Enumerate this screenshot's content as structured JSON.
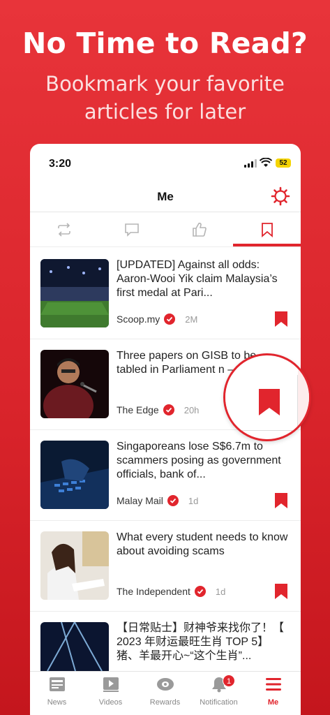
{
  "hero": {
    "title": "No Time to Read?",
    "subtitle": "Bookmark your favorite articles for later"
  },
  "status": {
    "time": "3:20",
    "battery": "52"
  },
  "topbar": {
    "title": "Me"
  },
  "tabs": [
    {
      "icon": "repost-icon"
    },
    {
      "icon": "comment-icon"
    },
    {
      "icon": "like-icon"
    },
    {
      "icon": "bookmark-icon",
      "active": true
    }
  ],
  "articles": [
    {
      "headline": "[UPDATED] Against all odds: Aaron-Wooi Yik claim Malaysia’s first medal at Pari...",
      "source": "Scoop.my",
      "age": "2M"
    },
    {
      "headline": "Three papers on GISB to be tabled in Parliament n — Azalina",
      "source": "The Edge",
      "age": "20h"
    },
    {
      "headline": "Singaporeans lose S$6.7m to scammers posing as government officials, bank of...",
      "source": "Malay Mail",
      "age": "1d"
    },
    {
      "headline": "What every student needs to know about avoiding scams",
      "source": "The Independent",
      "age": "1d"
    },
    {
      "headline": "【日常贴士】财神爷来找你了！【 2023 年财运最旺生肖 TOP 5】猪、羊最开心~“这个生肖”...",
      "source": "",
      "age": ""
    }
  ],
  "tabbar": {
    "items": [
      {
        "label": "News",
        "icon": "news-icon"
      },
      {
        "label": "Videos",
        "icon": "video-icon"
      },
      {
        "label": "Rewards",
        "icon": "rewards-icon"
      },
      {
        "label": "Notification",
        "icon": "bell-icon",
        "badge": "1"
      },
      {
        "label": "Me",
        "icon": "menu-icon",
        "active": true
      }
    ]
  },
  "colors": {
    "accent": "#e1252d",
    "hero_bg": "#e0282f"
  }
}
